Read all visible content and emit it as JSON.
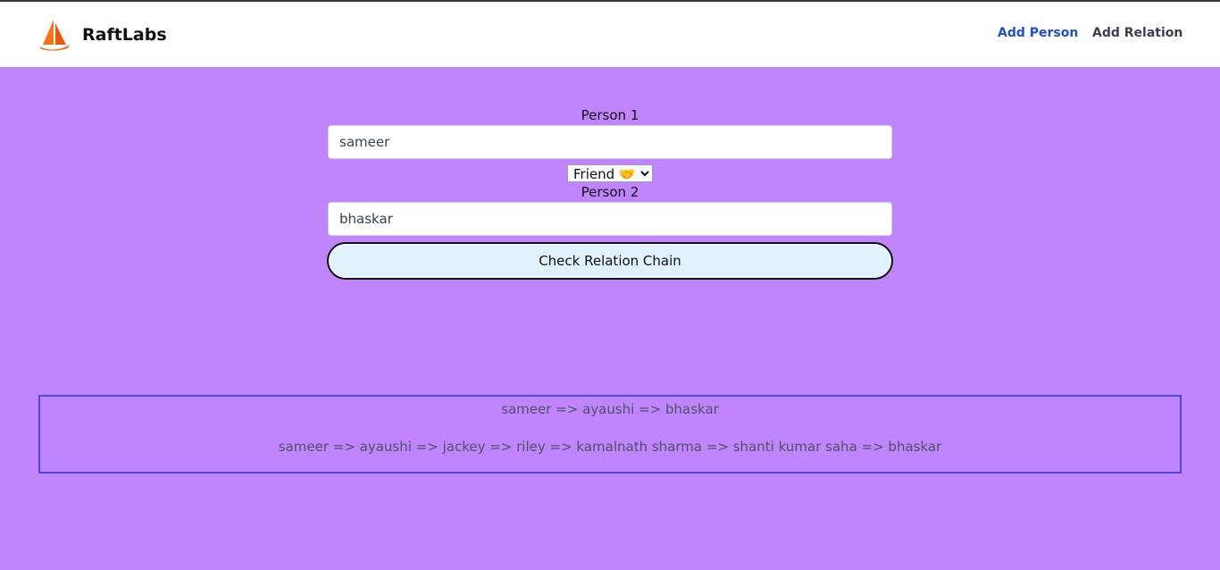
{
  "navbar": {
    "brand_name": "RaftLabs",
    "links": {
      "add_person": "Add Person",
      "add_relation": "Add Relation"
    },
    "colors": {
      "active_link": "#1d4ed8",
      "logo": "#f97316"
    }
  },
  "form": {
    "person1_label": "Person 1",
    "person1_value": "sameer",
    "relation_selected": "Friend 🤝",
    "person2_label": "Person 2",
    "person2_value": "bhaskar",
    "submit_label": "Check Relation Chain"
  },
  "results": {
    "chains": [
      "sameer => ayaushi => bhaskar",
      "sameer => ayaushi => jackey => riley => kamalnath sharma => shanti kumar saha => bhaskar"
    ]
  },
  "theme": {
    "background": "#c084fc",
    "button_bg": "#e0f2fe",
    "results_border": "#4f46e5"
  }
}
